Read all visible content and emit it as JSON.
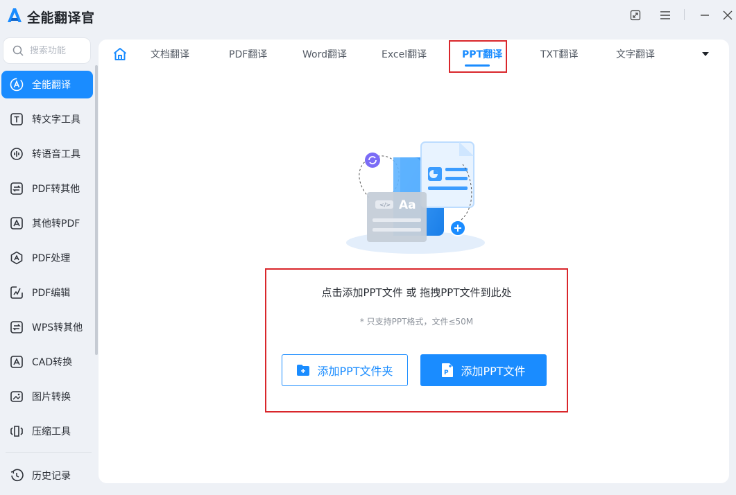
{
  "app": {
    "title": "全能翻译官",
    "brand_color": "#1a8cff"
  },
  "window_controls": [
    "restore-icon",
    "menu-icon",
    "minimize-icon",
    "close-icon"
  ],
  "search": {
    "placeholder": "搜索功能"
  },
  "sidebar": {
    "items": [
      {
        "label": "全能翻译",
        "icon": "translate-icon",
        "active": true
      },
      {
        "label": "转文字工具",
        "icon": "text-tool-icon"
      },
      {
        "label": "转语音工具",
        "icon": "voice-tool-icon"
      },
      {
        "label": "PDF转其他",
        "icon": "pdf-convert-icon"
      },
      {
        "label": "其他转PDF",
        "icon": "to-pdf-icon"
      },
      {
        "label": "PDF处理",
        "icon": "pdf-process-icon"
      },
      {
        "label": "PDF编辑",
        "icon": "pdf-edit-icon"
      },
      {
        "label": "WPS转其他",
        "icon": "wps-convert-icon"
      },
      {
        "label": "CAD转换",
        "icon": "cad-convert-icon"
      },
      {
        "label": "图片转换",
        "icon": "image-convert-icon"
      },
      {
        "label": "压缩工具",
        "icon": "compress-icon"
      }
    ],
    "history": {
      "label": "历史记录",
      "icon": "history-icon"
    }
  },
  "tabs": {
    "items": [
      {
        "label": "文档翻译"
      },
      {
        "label": "PDF翻译"
      },
      {
        "label": "Word翻译"
      },
      {
        "label": "Excel翻译"
      },
      {
        "label": "PPT翻译",
        "active": true
      },
      {
        "label": "TXT翻译"
      },
      {
        "label": "文字翻译"
      }
    ]
  },
  "dropzone": {
    "title": "点击添加PPT文件 或 拖拽PPT文件到此处",
    "note": "* 只支持PPT格式，文件≤50M",
    "add_folder_label": "添加PPT文件夹",
    "add_file_label": "添加PPT文件"
  },
  "colors": {
    "highlight": "#d9262b",
    "accent": "#1a8cff",
    "background": "#eef1f6"
  }
}
